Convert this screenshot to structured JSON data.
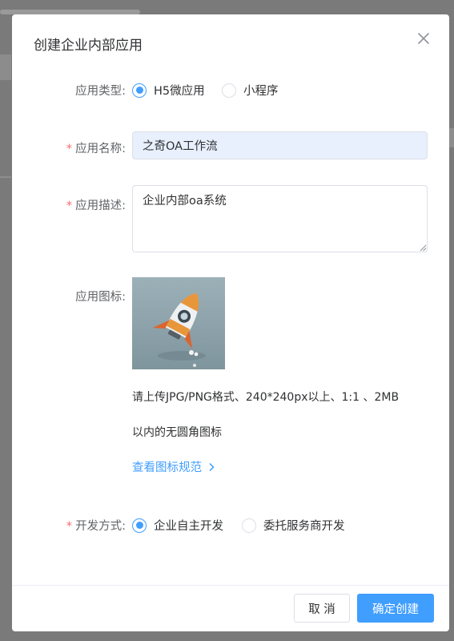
{
  "dialog": {
    "title": "创建企业内部应用"
  },
  "form": {
    "app_type": {
      "label": "应用类型:",
      "options": [
        {
          "label": "H5微应用",
          "checked": true
        },
        {
          "label": "小程序",
          "checked": false
        }
      ]
    },
    "app_name": {
      "required_mark": "*",
      "label": "应用名称:",
      "value": "之奇OA工作流"
    },
    "app_desc": {
      "required_mark": "*",
      "label": "应用描述:",
      "value": "企业内部oa系统"
    },
    "app_icon": {
      "label": "应用图标:",
      "hint_line1": "请上传JPG/PNG格式、240*240px以上、1:1 、2MB",
      "hint_line2": "以内的无圆角图标",
      "spec_link": "查看图标规范",
      "spec_link_arrow": "chevron-right-icon"
    },
    "dev_mode": {
      "required_mark": "*",
      "label": "开发方式:",
      "options": [
        {
          "label": "企业自主开发",
          "checked": true
        },
        {
          "label": "委托服务商开发",
          "checked": false
        }
      ]
    }
  },
  "footer": {
    "cancel_label": "取 消",
    "confirm_label": "确定创建"
  },
  "colors": {
    "primary": "#409eff",
    "required": "#f56c6c",
    "input_filled_bg": "#e8f0fe",
    "overlay": "#7a7a7a"
  }
}
